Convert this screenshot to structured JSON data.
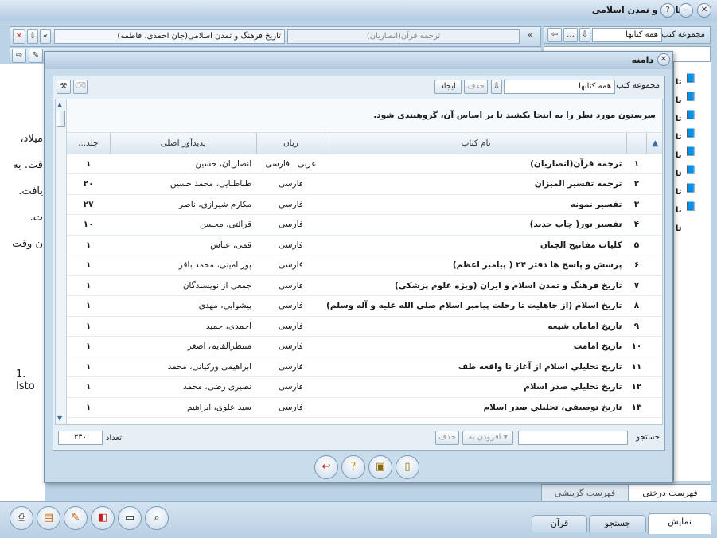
{
  "app": {
    "title": "تاریخ و تمدن اسلامی"
  },
  "top_tabs": {
    "tab1": "تاریخ فرهنگ و تمدن اسلامی(جان احمدی، فاطمه)",
    "tab2": "ترجمه قرآن(انصاريان)"
  },
  "right_panel": {
    "label": "مجموعه کتب",
    "select_value": "همه کتابها",
    "list_prefixes": [
      "تا",
      "تا",
      "تا",
      "تا",
      "تا",
      "تا",
      "تا",
      "تا",
      "تا"
    ]
  },
  "left_text": {
    "lines": [
      "میلاد،",
      "قت. به",
      "یافت.",
      "ت.",
      "ن وقت"
    ],
    "footnote": "1. Isto"
  },
  "dialog": {
    "title": "دامنه",
    "collection_label": "مجموعه کتب",
    "collection_value": "همه کتابها",
    "create_btn": "ایجاد",
    "delete_btn": "حذف",
    "group_hint": "سرستون مورد نظر را به اینجا بکشید تا بر اساس آن، گروهبندی شود.",
    "columns": {
      "name": "نام کتاب",
      "lang": "زبان",
      "author": "پدیدآور اصلی",
      "vol": "جلد..."
    },
    "rows": [
      {
        "n": "١",
        "name": "ترجمه قرآن(انصاريان)",
        "lang": "عربی ـ فارسی",
        "author": "انصاريان، حسين",
        "vol": "١"
      },
      {
        "n": "٢",
        "name": "ترجمه تفسير الميزان",
        "lang": "فارسی",
        "author": "طباطبايی، محمد حسين",
        "vol": "٢٠"
      },
      {
        "n": "٣",
        "name": "تفسير نمونه",
        "lang": "فارسی",
        "author": "مکارم شيرازی، ناصر",
        "vol": "٢٧"
      },
      {
        "n": "۴",
        "name": "تفسير نور( چاپ جديد)",
        "lang": "فارسی",
        "author": "قرائتی، محسن",
        "vol": "١٠"
      },
      {
        "n": "۵",
        "name": "کليات مفاتيح الجنان",
        "lang": "فارسی",
        "author": "قمی، عباس",
        "vol": "١"
      },
      {
        "n": "۶",
        "name": "پرسش و پاسخ ها دفتر ٢۴ ( پيامبر اعظم)",
        "lang": "فارسی",
        "author": "پور امينی، محمد باقر",
        "vol": "١"
      },
      {
        "n": "٧",
        "name": "تاريخ فرهنگ و تمدن اسلام و ايران (ويژه علوم پزشکی)",
        "lang": "فارسی",
        "author": "جمعی از نويسندگان",
        "vol": "١"
      },
      {
        "n": "٨",
        "name": "تاريخ اسلام (از جاهليت تا رحلت پيامبر اسلام صلي الله عليه و آله وسلم)",
        "lang": "فارسی",
        "author": "پيشوايی، مهدی",
        "vol": "١"
      },
      {
        "n": "٩",
        "name": "تاريخ امامان شيعه",
        "lang": "فارسی",
        "author": "احمدی، حميد",
        "vol": "١"
      },
      {
        "n": "١٠",
        "name": "تاريخ امامت",
        "lang": "فارسی",
        "author": "منتظرالقايم، اصغر",
        "vol": "١"
      },
      {
        "n": "١١",
        "name": "تاريخ تحليلي اسلام از آغاز تا واقعه طف",
        "lang": "فارسی",
        "author": "ابراهيمی ورکيانی، محمد",
        "vol": "١"
      },
      {
        "n": "١٢",
        "name": "تاريخ تحليلي صدر اسلام",
        "lang": "فارسی",
        "author": "نصيری رضی، محمد",
        "vol": "١"
      },
      {
        "n": "١٣",
        "name": "تاريخ توصيفي، تحليلي صدر اسلام",
        "lang": "فارسی",
        "author": "سيد علوی، ابراهيم",
        "vol": "١"
      }
    ],
    "search_label": "جستجو",
    "add_to": "افزودن به",
    "delete2": "حذف",
    "count_label": "تعداد",
    "count_value": "٣۴٠"
  },
  "bottom_tabs": {
    "show": "نمایش",
    "search": "جستجو",
    "quran": "قرآن"
  },
  "side_tabs": {
    "tree": "فهرست درختی",
    "select": "فهرست گزینشی"
  },
  "colors": {
    "accent": "#c9dcec",
    "close_red": "#d03030"
  }
}
